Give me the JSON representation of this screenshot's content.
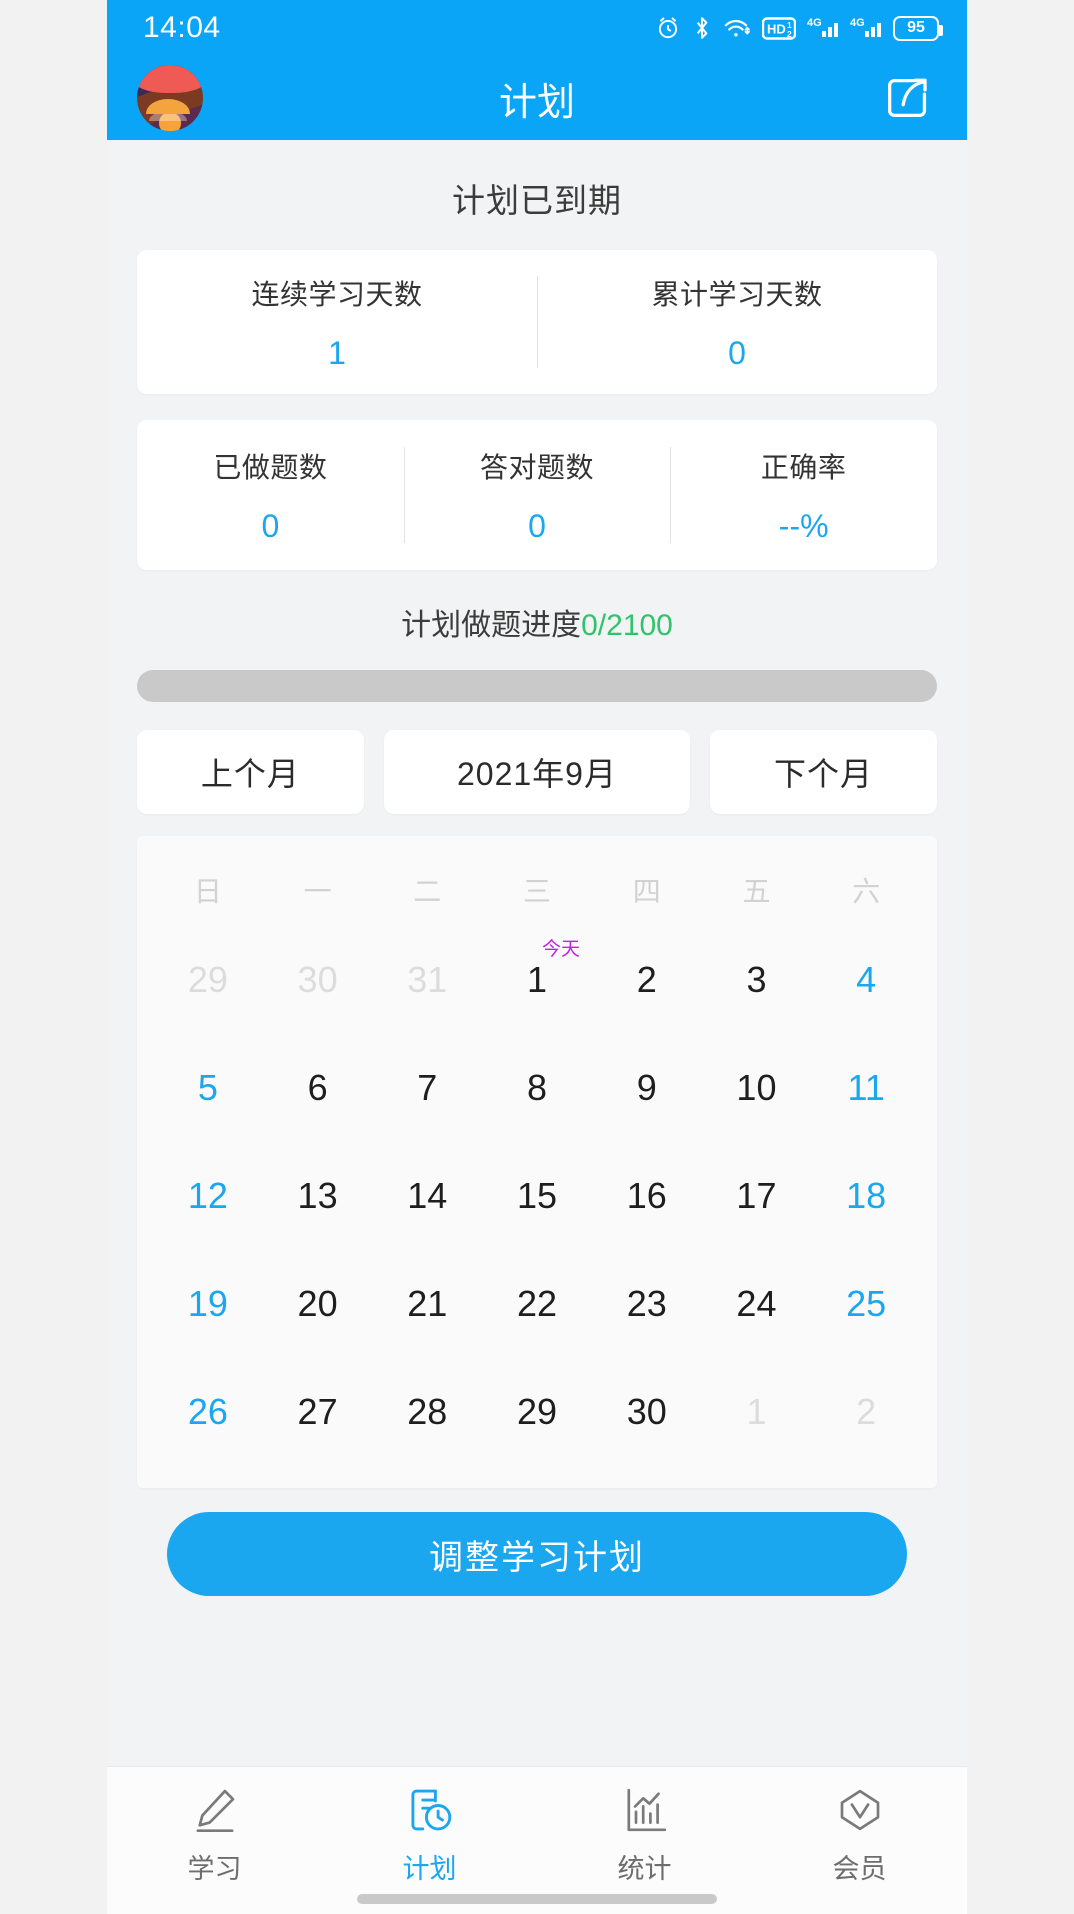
{
  "status_bar": {
    "time": "14:04",
    "battery_level": "95",
    "icons": [
      "alarm-icon",
      "bluetooth-icon",
      "wifi-icon",
      "hd-volte-icon",
      "signal-4g-1-icon",
      "signal-4g-2-icon",
      "battery-icon"
    ]
  },
  "app_bar": {
    "title": "计划",
    "avatar": "user-avatar",
    "share_icon": "share-icon"
  },
  "plan": {
    "status_text": "计划已到期"
  },
  "stats_top": [
    {
      "label": "连续学习天数",
      "value": "1"
    },
    {
      "label": "累计学习天数",
      "value": "0"
    }
  ],
  "stats_mid": [
    {
      "label": "已做题数",
      "value": "0"
    },
    {
      "label": "答对题数",
      "value": "0"
    },
    {
      "label": "正确率",
      "value": "--%"
    }
  ],
  "progress": {
    "label": "计划做题进度",
    "value_text": "0/2100",
    "done": 0,
    "total": 2100,
    "percent": 0,
    "value_color": "#2ec46b",
    "track_color": "#c9c9c9"
  },
  "month_nav": {
    "prev_label": "上个月",
    "current_label": "2021年9月",
    "next_label": "下个月"
  },
  "calendar": {
    "year": 2021,
    "month": 9,
    "weekdays": [
      "日",
      "一",
      "二",
      "三",
      "四",
      "五",
      "六"
    ],
    "today_badge": "今天",
    "weeks": [
      [
        {
          "d": "29",
          "t": "dim"
        },
        {
          "d": "30",
          "t": "dim"
        },
        {
          "d": "31",
          "t": "dim"
        },
        {
          "d": "1",
          "t": "day",
          "today": true
        },
        {
          "d": "2",
          "t": "day"
        },
        {
          "d": "3",
          "t": "day"
        },
        {
          "d": "4",
          "t": "weekend"
        }
      ],
      [
        {
          "d": "5",
          "t": "weekend"
        },
        {
          "d": "6",
          "t": "day"
        },
        {
          "d": "7",
          "t": "day"
        },
        {
          "d": "8",
          "t": "day"
        },
        {
          "d": "9",
          "t": "day"
        },
        {
          "d": "10",
          "t": "day"
        },
        {
          "d": "11",
          "t": "weekend"
        }
      ],
      [
        {
          "d": "12",
          "t": "weekend"
        },
        {
          "d": "13",
          "t": "day"
        },
        {
          "d": "14",
          "t": "day"
        },
        {
          "d": "15",
          "t": "day"
        },
        {
          "d": "16",
          "t": "day"
        },
        {
          "d": "17",
          "t": "day"
        },
        {
          "d": "18",
          "t": "weekend"
        }
      ],
      [
        {
          "d": "19",
          "t": "weekend"
        },
        {
          "d": "20",
          "t": "day"
        },
        {
          "d": "21",
          "t": "day"
        },
        {
          "d": "22",
          "t": "day"
        },
        {
          "d": "23",
          "t": "day"
        },
        {
          "d": "24",
          "t": "day"
        },
        {
          "d": "25",
          "t": "weekend"
        }
      ],
      [
        {
          "d": "26",
          "t": "weekend"
        },
        {
          "d": "27",
          "t": "day"
        },
        {
          "d": "28",
          "t": "day"
        },
        {
          "d": "29",
          "t": "day"
        },
        {
          "d": "30",
          "t": "day"
        },
        {
          "d": "1",
          "t": "dim"
        },
        {
          "d": "2",
          "t": "dim"
        }
      ]
    ]
  },
  "cta": {
    "label": "调整学习计划"
  },
  "tabbar": {
    "items": [
      {
        "label": "学习",
        "icon": "pencil-icon",
        "active": false
      },
      {
        "label": "计划",
        "icon": "plan-clock-icon",
        "active": true
      },
      {
        "label": "统计",
        "icon": "bar-chart-icon",
        "active": false
      },
      {
        "label": "会员",
        "icon": "diamond-check-icon",
        "active": false
      }
    ]
  },
  "colors": {
    "brand": "#0aa5f7",
    "accent": "#1aa7f0",
    "green": "#2ec46b",
    "today": "#c020e0"
  }
}
